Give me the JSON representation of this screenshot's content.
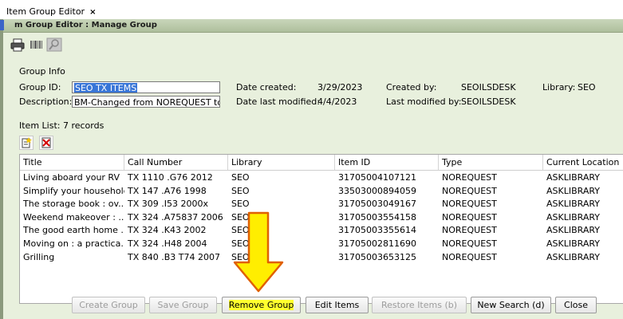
{
  "tab": {
    "title": "Item Group Editor",
    "close": "×"
  },
  "window": {
    "title": "m Group Editor : Manage Group"
  },
  "toolbar": {
    "icons": [
      "printer-icon",
      "barcode-icon",
      "search-disabled-icon"
    ]
  },
  "group_info": {
    "heading": "Group Info",
    "group_id_label": "Group ID:",
    "group_id_value": "SEO TX ITEMS",
    "description_label": "Description:",
    "description_value": "BM-Changed from NOREQUEST to I",
    "date_created_label": "Date created:",
    "date_created_value": "3/29/2023",
    "date_modified_label": "Date last modified:",
    "date_modified_value": "4/4/2023",
    "created_by_label": "Created by:",
    "created_by_value": "SEOILSDESK",
    "modified_by_label": "Last modified by:",
    "modified_by_value": "SEOILSDESK",
    "library_label": "Library:",
    "library_value": "SEO"
  },
  "item_list": {
    "heading": "Item List: 7 records",
    "columns": [
      "Title",
      "Call Number",
      "Library",
      "Item ID",
      "Type",
      "Current Location"
    ],
    "rows": [
      [
        "Living aboard your RV",
        "TX 1110 .G76 2012",
        "SEO",
        "31705004107121",
        "NOREQUEST",
        "ASKLIBRARY"
      ],
      [
        "Simplify your household",
        "TX 147 .A76 1998",
        "SEO",
        "33503000894059",
        "NOREQUEST",
        "ASKLIBRARY"
      ],
      [
        "The storage book : ov...",
        "TX 309 .I53 2000x",
        "SEO",
        "31705003049167",
        "NOREQUEST",
        "ASKLIBRARY"
      ],
      [
        "Weekend makeover : ...",
        "TX 324 .A75837 2006",
        "SEO",
        "31705003554158",
        "NOREQUEST",
        "ASKLIBRARY"
      ],
      [
        "The good earth home ...",
        "TX 324 .K43 2002",
        "SEO",
        "31705003355614",
        "NOREQUEST",
        "ASKLIBRARY"
      ],
      [
        "Moving on : a practica...",
        "TX 324 .H48 2004",
        "SEO",
        "31705002811690",
        "NOREQUEST",
        "ASKLIBRARY"
      ],
      [
        "Grilling",
        "TX 840 .B3 T74 2007",
        "SEO",
        "31705003653125",
        "NOREQUEST",
        "ASKLIBRARY"
      ]
    ]
  },
  "buttons": {
    "create_group": "Create Group",
    "save_group": "Save Group",
    "remove_group": "Remove Group",
    "edit_items": "Edit Items",
    "restore_items": "Restore Items (b)",
    "new_search": "New Search (d)",
    "close": "Close"
  },
  "colors": {
    "highlight": "#ffff2e",
    "arrow": "#ffee00",
    "selection": "#3875d7"
  }
}
